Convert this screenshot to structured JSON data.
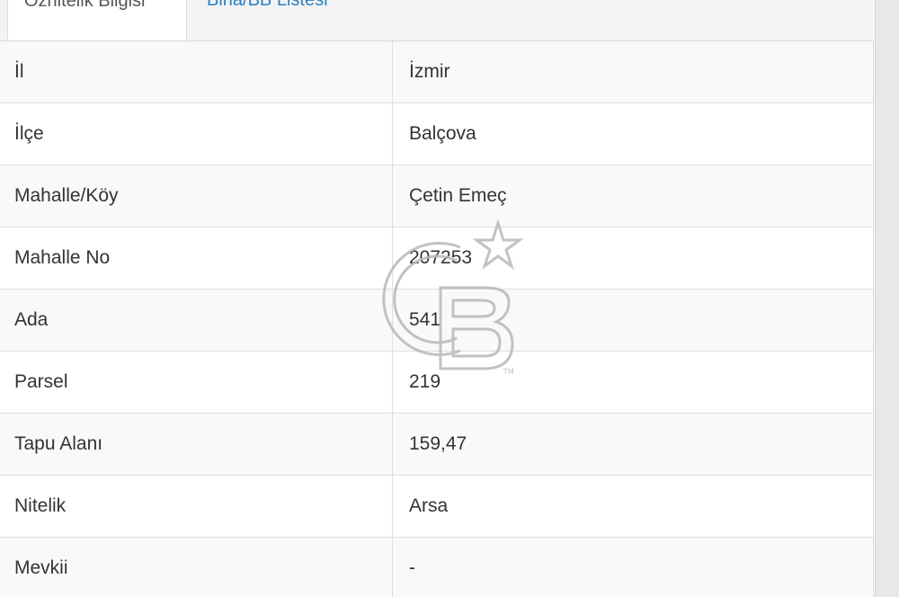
{
  "tabs": [
    {
      "label": "Öznitelik Bilgisi",
      "active": true
    },
    {
      "label": "Bina/BB Listesi",
      "active": false
    }
  ],
  "rows": [
    {
      "key": "İl",
      "value": "İzmir"
    },
    {
      "key": "İlçe",
      "value": "Balçova"
    },
    {
      "key": "Mahalle/Köy",
      "value": "Çetin Emeç"
    },
    {
      "key": "Mahalle No",
      "value": "207253"
    },
    {
      "key": "Ada",
      "value": "541"
    },
    {
      "key": "Parsel",
      "value": "219"
    },
    {
      "key": "Tapu Alanı",
      "value": "159,47"
    },
    {
      "key": "Nitelik",
      "value": "Arsa"
    },
    {
      "key": "Mevkii",
      "value": "-"
    }
  ],
  "watermark": {
    "icon": "cb-logo-watermark"
  },
  "colors": {
    "tab_link": "#2a7fc1",
    "text": "#333333",
    "border": "#dedede"
  }
}
